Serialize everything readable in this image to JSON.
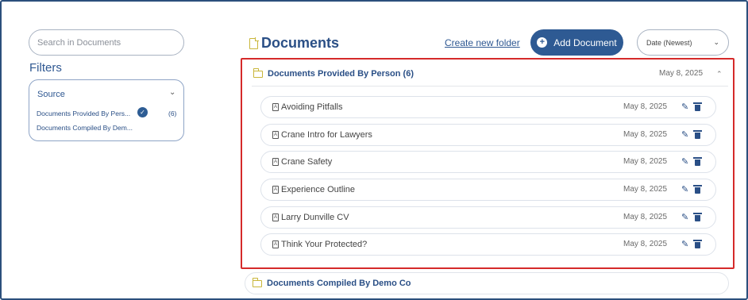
{
  "search": {
    "placeholder": "Search in Documents"
  },
  "filters": {
    "title": "Filters",
    "source_label": "Source",
    "items": [
      {
        "label": "Documents Provided By Pers...",
        "count": "(6)",
        "checked": true
      },
      {
        "label": "Documents Compiled By Dem...",
        "checked": false
      }
    ]
  },
  "header": {
    "title": "Documents",
    "create_folder_label": "Create new folder",
    "add_document_label": "Add Document",
    "sort_value": "Date (Newest)"
  },
  "groups": [
    {
      "title": "Documents Provided By Person (6)",
      "date": "May 8, 2025",
      "expanded": true,
      "documents": [
        {
          "name": "Avoiding Pitfalls",
          "date": "May 8, 2025"
        },
        {
          "name": "Crane Intro for Lawyers",
          "date": "May 8, 2025"
        },
        {
          "name": "Crane Safety",
          "date": "May 8, 2025"
        },
        {
          "name": "Experience Outline",
          "date": "May 8, 2025"
        },
        {
          "name": "Larry Dunville CV",
          "date": "May 8, 2025"
        },
        {
          "name": "Think Your Protected?",
          "date": "May 8, 2025"
        }
      ]
    },
    {
      "title": "Documents Compiled By Demo Co",
      "expanded": false
    }
  ],
  "colors": {
    "accent": "#2e5a93",
    "highlight_border": "#d52a2a",
    "folder": "#c9b63a"
  }
}
